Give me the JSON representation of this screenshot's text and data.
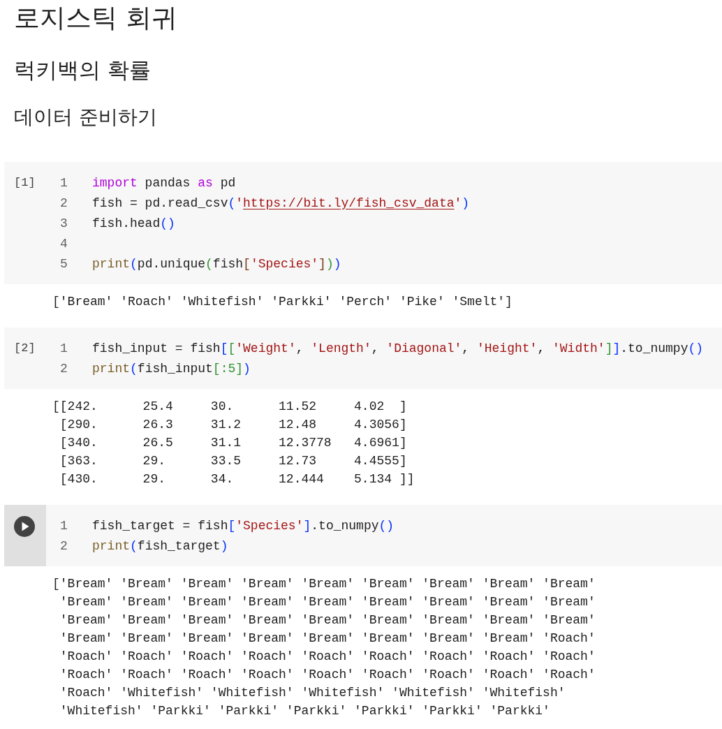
{
  "headings": [
    {
      "kind": "title",
      "text": "로지스틱 회귀"
    },
    {
      "kind": "section",
      "text": "럭키백의 확률"
    },
    {
      "kind": "subsection",
      "text": "데이터 준비하기"
    }
  ],
  "cells": [
    {
      "kind": "executed",
      "prompt": "[1]",
      "lines": [
        {
          "number": "1",
          "tokens": [
            {
              "kind": "keyword",
              "text": "import"
            },
            {
              "kind": "plain",
              "text": " pandas "
            },
            {
              "kind": "keyword",
              "text": "as"
            },
            {
              "kind": "plain",
              "text": " pd"
            }
          ]
        },
        {
          "number": "2",
          "tokens": [
            {
              "kind": "plain",
              "text": "fish = pd.read_csv"
            },
            {
              "kind": "bracket1",
              "text": "("
            },
            {
              "kind": "string",
              "text": "'"
            },
            {
              "kind": "link",
              "text": "https://bit.ly/fish_csv_data"
            },
            {
              "kind": "string",
              "text": "'"
            },
            {
              "kind": "bracket1",
              "text": ")"
            }
          ]
        },
        {
          "number": "3",
          "tokens": [
            {
              "kind": "plain",
              "text": "fish.head"
            },
            {
              "kind": "bracket1",
              "text": "()"
            }
          ]
        },
        {
          "number": "4"
        },
        {
          "number": "5",
          "tokens": [
            {
              "kind": "function",
              "text": "print"
            },
            {
              "kind": "bracket1",
              "text": "("
            },
            {
              "kind": "plain",
              "text": "pd.unique"
            },
            {
              "kind": "bracket2",
              "text": "("
            },
            {
              "kind": "plain",
              "text": "fish"
            },
            {
              "kind": "bracket3",
              "text": "["
            },
            {
              "kind": "string",
              "text": "'Species'"
            },
            {
              "kind": "bracket3",
              "text": "]"
            },
            {
              "kind": "bracket2",
              "text": ")"
            },
            {
              "kind": "bracket1",
              "text": ")"
            }
          ]
        }
      ],
      "output": [
        "['Bream' 'Roach' 'Whitefish' 'Parkki' 'Perch' 'Pike' 'Smelt']"
      ]
    },
    {
      "kind": "executed",
      "prompt": "[2]",
      "lines": [
        {
          "number": "1",
          "tokens": [
            {
              "kind": "plain",
              "text": "fish_input = fish"
            },
            {
              "kind": "bracket1",
              "text": "["
            },
            {
              "kind": "bracket2",
              "text": "["
            },
            {
              "kind": "string",
              "text": "'Weight'"
            },
            {
              "kind": "plain",
              "text": ", "
            },
            {
              "kind": "string",
              "text": "'Length'"
            },
            {
              "kind": "plain",
              "text": ", "
            },
            {
              "kind": "string",
              "text": "'Diagonal'"
            },
            {
              "kind": "plain",
              "text": ", "
            },
            {
              "kind": "string",
              "text": "'Height'"
            },
            {
              "kind": "plain",
              "text": ", "
            },
            {
              "kind": "string",
              "text": "'Width'"
            },
            {
              "kind": "bracket2",
              "text": "]"
            },
            {
              "kind": "bracket1",
              "text": "]"
            },
            {
              "kind": "plain",
              "text": ".to_numpy"
            },
            {
              "kind": "bracket1",
              "text": "()"
            }
          ]
        },
        {
          "number": "2",
          "tokens": [
            {
              "kind": "function",
              "text": "print"
            },
            {
              "kind": "bracket1",
              "text": "("
            },
            {
              "kind": "plain",
              "text": "fish_input"
            },
            {
              "kind": "bracket2",
              "text": "[:5]"
            },
            {
              "kind": "bracket1",
              "text": ")"
            }
          ]
        }
      ],
      "output": [
        "[[242.      25.4     30.      11.52     4.02  ]",
        " [290.      26.3     31.2     12.48     4.3056]",
        " [340.      26.5     31.1     12.3778   4.6961]",
        " [363.      29.      33.5     12.73     4.4555]",
        " [430.      29.      34.      12.444    5.134 ]]"
      ]
    },
    {
      "kind": "run_button",
      "lines": [
        {
          "number": "1",
          "tokens": [
            {
              "kind": "plain",
              "text": "fish_target = fish"
            },
            {
              "kind": "bracket1",
              "text": "["
            },
            {
              "kind": "string",
              "text": "'Species'"
            },
            {
              "kind": "bracket1",
              "text": "]"
            },
            {
              "kind": "plain",
              "text": ".to_numpy"
            },
            {
              "kind": "bracket1",
              "text": "()"
            }
          ]
        },
        {
          "number": "2",
          "tokens": [
            {
              "kind": "function",
              "text": "print"
            },
            {
              "kind": "bracket1",
              "text": "("
            },
            {
              "kind": "plain",
              "text": "fish_target"
            },
            {
              "kind": "bracket1",
              "text": ")"
            }
          ]
        }
      ],
      "output": [
        "['Bream' 'Bream' 'Bream' 'Bream' 'Bream' 'Bream' 'Bream' 'Bream' 'Bream'",
        " 'Bream' 'Bream' 'Bream' 'Bream' 'Bream' 'Bream' 'Bream' 'Bream' 'Bream'",
        " 'Bream' 'Bream' 'Bream' 'Bream' 'Bream' 'Bream' 'Bream' 'Bream' 'Bream'",
        " 'Bream' 'Bream' 'Bream' 'Bream' 'Bream' 'Bream' 'Bream' 'Bream' 'Roach'",
        " 'Roach' 'Roach' 'Roach' 'Roach' 'Roach' 'Roach' 'Roach' 'Roach' 'Roach'",
        " 'Roach' 'Roach' 'Roach' 'Roach' 'Roach' 'Roach' 'Roach' 'Roach' 'Roach'",
        " 'Roach' 'Whitefish' 'Whitefish' 'Whitefish' 'Whitefish' 'Whitefish'",
        " 'Whitefish' 'Parkki' 'Parkki' 'Parkki' 'Parkki' 'Parkki' 'Parkki'"
      ]
    }
  ]
}
